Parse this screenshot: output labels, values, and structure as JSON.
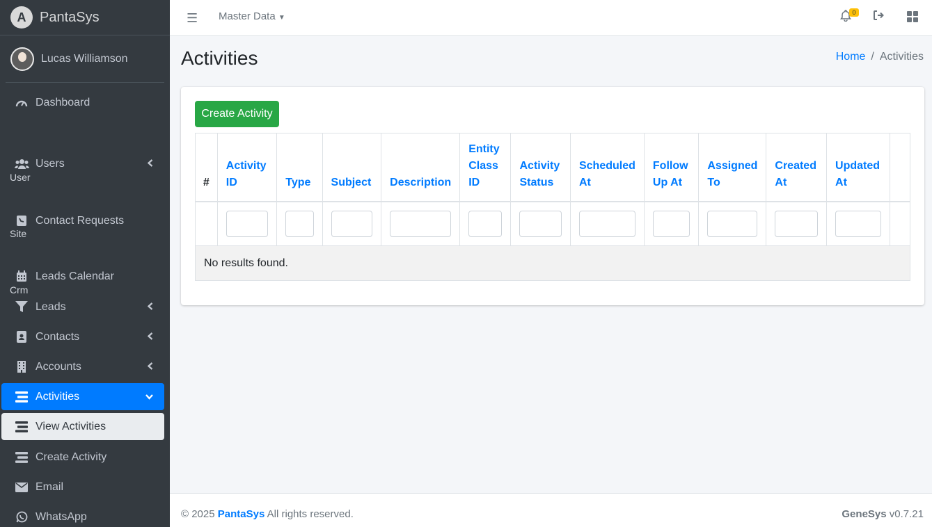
{
  "brand": {
    "name": "PantaSys",
    "logo_letter": "A"
  },
  "user": {
    "name": "Lucas Williamson"
  },
  "sidebar": {
    "items": [
      {
        "type": "item",
        "label": "Dashboard",
        "icon": "tachometer-icon"
      },
      {
        "type": "header",
        "label": "User"
      },
      {
        "type": "item",
        "label": "Users",
        "icon": "users-icon",
        "chevron": "left"
      },
      {
        "type": "header",
        "label": "Site"
      },
      {
        "type": "item",
        "label": "Contact Requests",
        "icon": "contact-card-icon"
      },
      {
        "type": "header",
        "label": "Crm"
      },
      {
        "type": "item",
        "label": "Leads Calendar",
        "icon": "calendar-icon"
      },
      {
        "type": "item",
        "label": "Leads",
        "icon": "filter-icon",
        "chevron": "left"
      },
      {
        "type": "item",
        "label": "Contacts",
        "icon": "address-book-icon",
        "chevron": "left"
      },
      {
        "type": "item",
        "label": "Accounts",
        "icon": "building-icon",
        "chevron": "left"
      },
      {
        "type": "item",
        "label": "Activities",
        "icon": "list-icon",
        "chevron": "down",
        "state": "active"
      },
      {
        "type": "item",
        "label": "View Activities",
        "icon": "list-icon",
        "state": "sub-active"
      },
      {
        "type": "item",
        "label": "Create Activity",
        "icon": "list-icon"
      },
      {
        "type": "item",
        "label": "Email",
        "icon": "envelope-icon"
      },
      {
        "type": "item",
        "label": "WhatsApp",
        "icon": "whatsapp-icon"
      }
    ]
  },
  "topbar": {
    "menu_label": "Master Data",
    "notification_count": "0"
  },
  "page": {
    "title": "Activities",
    "breadcrumb": {
      "home": "Home",
      "current": "Activities"
    }
  },
  "card": {
    "create_button": "Create Activity",
    "columns": [
      {
        "label": "#",
        "lines": [
          "#"
        ]
      },
      {
        "label": "Activity ID",
        "lines": [
          "Activity",
          "ID"
        ]
      },
      {
        "label": "Type",
        "lines": [
          "Type"
        ]
      },
      {
        "label": "Subject",
        "lines": [
          "Subject"
        ]
      },
      {
        "label": "Description",
        "lines": [
          "Description"
        ]
      },
      {
        "label": "Entity Class ID",
        "lines": [
          "Entity",
          "Class",
          "ID"
        ]
      },
      {
        "label": "Activity Status",
        "lines": [
          "Activity",
          "Status"
        ]
      },
      {
        "label": "Scheduled At",
        "lines": [
          "Scheduled",
          "At"
        ]
      },
      {
        "label": "Follow Up At",
        "lines": [
          "Follow",
          "Up At"
        ]
      },
      {
        "label": "Assigned To",
        "lines": [
          "Assigned",
          "To"
        ]
      },
      {
        "label": "Created At",
        "lines": [
          "Created",
          "At"
        ]
      },
      {
        "label": "Updated At",
        "lines": [
          "Updated",
          "At"
        ]
      },
      {
        "label": "",
        "lines": []
      }
    ],
    "empty_message": "No results found."
  },
  "footer": {
    "copyright": "© 2025",
    "brand": "PantaSys",
    "rights": "All rights reserved.",
    "product": "GeneSys",
    "version": "v0.7.21"
  },
  "colors": {
    "sidebar_bg": "#343a40",
    "primary": "#007bff",
    "success": "#28a745",
    "warning": "#ffc107"
  }
}
